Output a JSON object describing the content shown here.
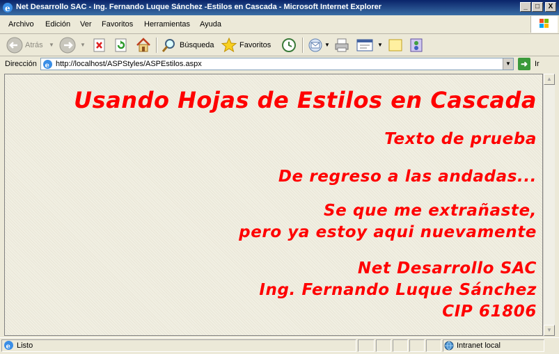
{
  "window": {
    "title": "Net Desarrollo SAC - Ing. Fernando Luque Sánchez -Estilos en Cascada - Microsoft Internet Explorer",
    "controls": [
      "_",
      "□",
      "X"
    ]
  },
  "menu": {
    "items": [
      "Archivo",
      "Edición",
      "Ver",
      "Favoritos",
      "Herramientas",
      "Ayuda"
    ]
  },
  "toolbar": {
    "back_label": "Atrás",
    "search_label": "Búsqueda",
    "favorites_label": "Favoritos"
  },
  "address": {
    "label": "Dirección",
    "url": "http://localhost/ASPStyles/ASPEstilos.aspx",
    "go_label": "Ir"
  },
  "page": {
    "heading": "Usando Hojas de Estilos en Cascada",
    "line1": "Texto de prueba",
    "line2": "De regreso a las andadas...",
    "line3a": "Se que me extrañaste,",
    "line3b": "pero ya estoy aqui nuevamente",
    "line4a": "Net Desarrollo SAC",
    "line4b": "Ing. Fernando Luque Sánchez",
    "line4c": "CIP 61806",
    "text_color": "#ff0000"
  },
  "status": {
    "text": "Listo",
    "zone": "Intranet local"
  }
}
